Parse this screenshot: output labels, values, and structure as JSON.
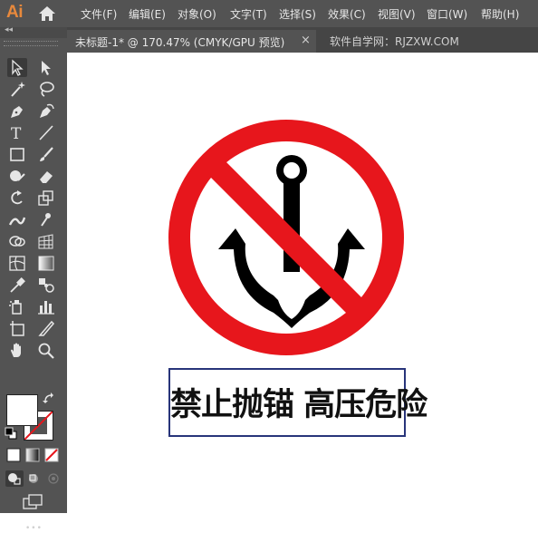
{
  "app": {
    "logo": "Ai"
  },
  "menu": [
    "文件(F)",
    "编辑(E)",
    "对象(O)",
    "文字(T)",
    "选择(S)",
    "效果(C)",
    "视图(V)",
    "窗口(W)",
    "帮助(H)"
  ],
  "document_tab": {
    "title": "未标题-1* @ 170.47% (CMYK/GPU 预览)",
    "close": "×"
  },
  "watermark": "软件自学网：RJZXW.COM",
  "toolbar": {
    "collapse": "◂◂",
    "more": "•••"
  },
  "artwork": {
    "sign_colors": {
      "ring": "#e7161c",
      "anchor": "#000000"
    },
    "label_text": "禁止抛锚  高压危险",
    "label_border_color": "#28347a"
  }
}
